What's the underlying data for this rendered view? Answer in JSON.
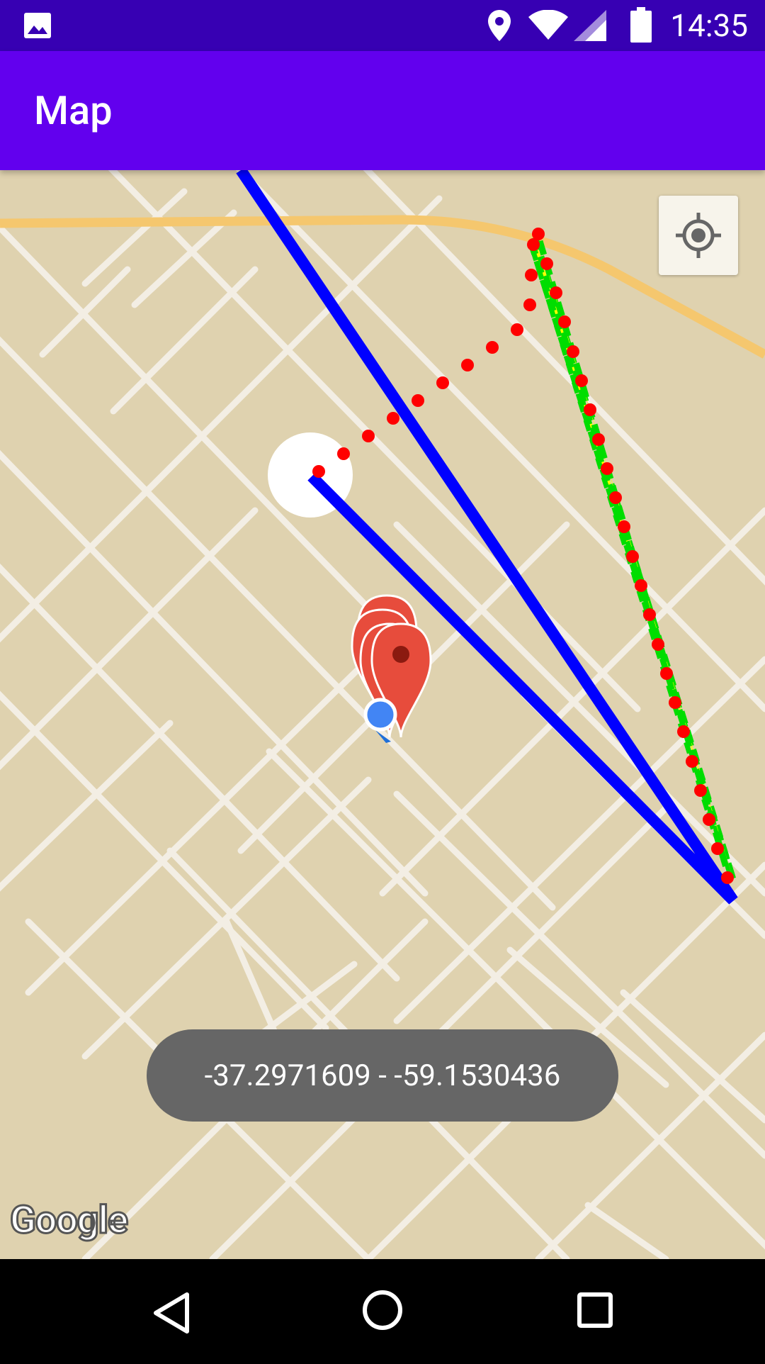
{
  "status_bar": {
    "time": "14:35",
    "icons": [
      "gallery-icon",
      "location-pin-icon",
      "wifi-icon",
      "cell-signal-icon",
      "battery-icon"
    ]
  },
  "app_bar": {
    "title": "Map"
  },
  "map": {
    "attribution": "Google",
    "my_location_icon": "my-location-icon",
    "overlays": {
      "polyline_blue_color": "#0000FF",
      "polyline_dotted_color": "#FF0000",
      "polygon_fill_color": "#FFFF00",
      "polygon_stroke_color": "#00DD00",
      "marker_color": "#E74C3C",
      "user_location_color": "#4285F4"
    }
  },
  "toast": {
    "message": "-37.2971609 - -59.1530436"
  },
  "nav_bar": {
    "icons": [
      "back-icon",
      "home-icon",
      "recents-icon"
    ]
  }
}
